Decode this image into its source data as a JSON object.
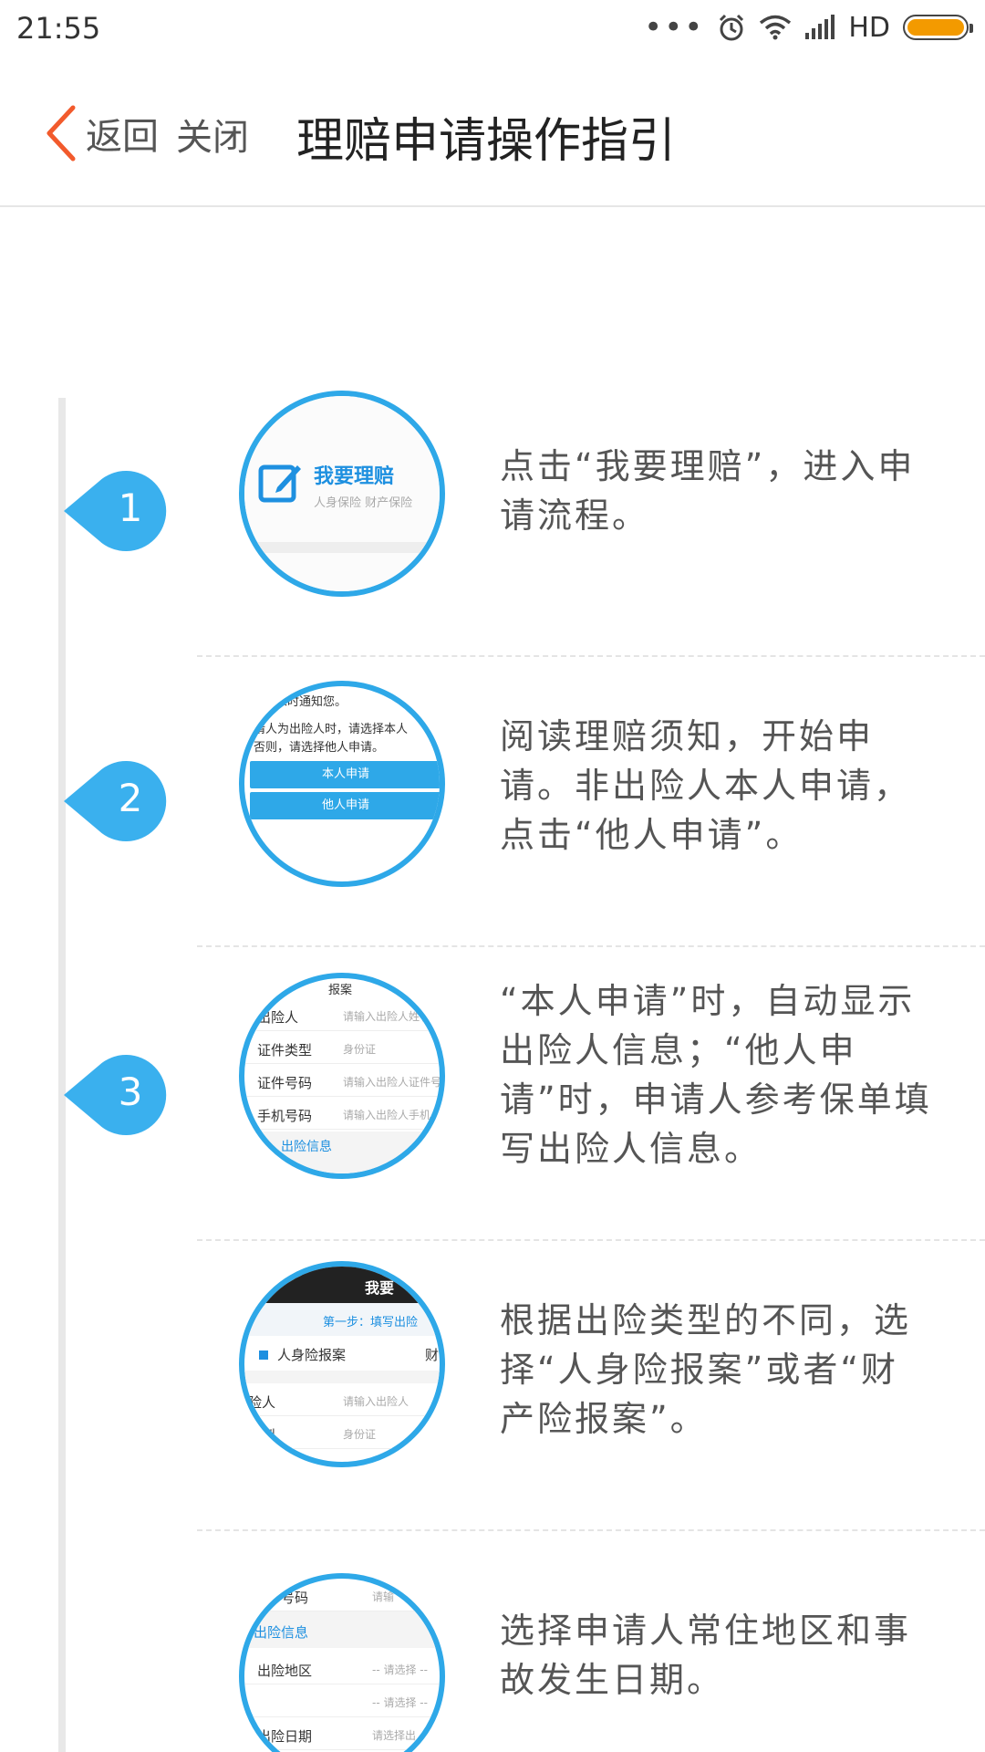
{
  "status_bar": {
    "time": "21:55",
    "dots": "•••",
    "network": "HD",
    "icons": [
      "alarm-icon",
      "wifi-icon",
      "signal-icon",
      "battery-icon"
    ],
    "battery_color": "#f39a00"
  },
  "nav": {
    "back_label": "返回",
    "close_label": "关闭",
    "title": "理赔申请操作指引",
    "back_color": "#f25a2c"
  },
  "accent_color": "#2ea8e8",
  "steps": [
    {
      "number": "1",
      "description": "点击“我要理赔”，进入申请流程。",
      "thumb": {
        "title": "我要理赔",
        "subtitle": "人身保险  财产保险"
      }
    },
    {
      "number": "2",
      "description": "阅读理赔须知，开始申请。非出险人本人申请，点击“他人申请”。",
      "thumb": {
        "text_1": "宋时通知您。",
        "text_2": "请人为出险人时，请选择本人",
        "text_3": "否则，请选择他人申请。",
        "button_1": "本人申请",
        "button_2": "他人申请"
      }
    },
    {
      "number": "3",
      "description": "“本人申请”时，自动显示出险人信息；“他人申请”时，申请人参考保单填写出险人信息。",
      "thumb": {
        "header": "报案",
        "rows": [
          {
            "label": "出险人",
            "hint": "请输入出险人姓名"
          },
          {
            "label": "证件类型",
            "hint": "身份证"
          },
          {
            "label": "证件号码",
            "hint": "请输入出险人证件号"
          },
          {
            "label": "手机号码",
            "hint": "请输入出险人手机"
          }
        ],
        "footer": "出险信息"
      }
    },
    {
      "number": "",
      "description": "根据出险类型的不同，选择“人身险报案”或者“财产险报案”。",
      "thumb": {
        "top_text": "我要",
        "step_text": "第一步：填写出险",
        "tab_1": "人身险报案",
        "tab_2": "财",
        "row_1_label": "险人",
        "row_1_hint": "请输入出险人",
        "row_2_label": "类型",
        "row_2_hint": "身份证"
      }
    },
    {
      "number": "",
      "description": "选择申请人常住地区和事故发生日期。",
      "thumb": {
        "row_0_label": "号码",
        "row_0_hint": "请输",
        "section": "出险信息",
        "row_1_label": "出险地区",
        "row_1_hint": "-- 请选择 --",
        "row_2_hint": "-- 请选择 --",
        "row_3_label": "出险日期",
        "row_3_hint": "请选择出"
      }
    }
  ]
}
